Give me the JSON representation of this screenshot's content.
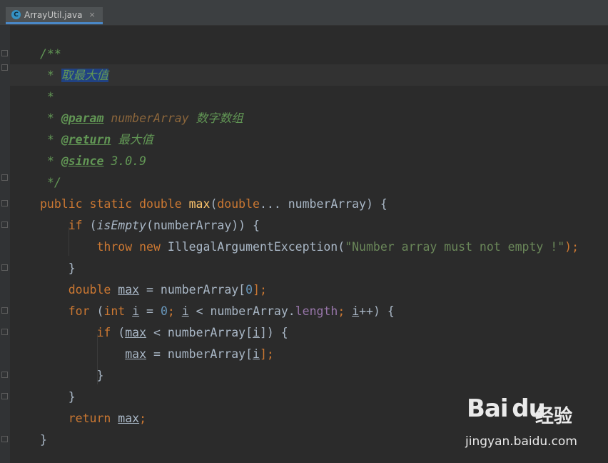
{
  "tab": {
    "icon": "java-class-icon",
    "icon_glyph": "C",
    "title": "ArrayUtil.java",
    "close": "×"
  },
  "code": {
    "l1": "/**",
    "l2_star": " * ",
    "l2_text": "取最大值",
    "l3": " *",
    "l4_star": " * ",
    "l4_tag": "@param",
    "l4_name": " numberArray",
    "l4_text": " 数字数组",
    "l5_star": " * ",
    "l5_tag": "@return",
    "l5_text": " 最大值",
    "l6_star": " * ",
    "l6_tag": "@since",
    "l6_text": " 3.0.9",
    "l7": " */",
    "l8_kw": "public static double ",
    "l8_fn": "max",
    "l8_p1": "(",
    "l8_kw2": "double",
    "l8_rest": "... numberArray) {",
    "l9_indent": "    ",
    "l9_kw": "if",
    "l9_p1": " (",
    "l9_fn": "isEmpty",
    "l9_rest": "(numberArray)) {",
    "l10_indent": "        ",
    "l10_kw": "throw new ",
    "l10_cls": "IllegalArgumentException(",
    "l10_str": "\"Number array must not empty !\"",
    "l10_end": ");",
    "l11": "    }",
    "l12_indent": "    ",
    "l12_kw": "double ",
    "l12_var": "max",
    "l12_mid": " = numberArray[",
    "l12_num": "0",
    "l12_end": "];",
    "l13_indent": "    ",
    "l13_kw": "for",
    "l13_a": " (",
    "l13_kw2": "int ",
    "l13_i1": "i",
    "l13_b": " = ",
    "l13_num": "0",
    "l13_c": "; ",
    "l13_i2": "i",
    "l13_d": " < numberArray.",
    "l13_fld": "length",
    "l13_e": "; ",
    "l13_i3": "i",
    "l13_f": "++) {",
    "l14_indent": "        ",
    "l14_kw": "if",
    "l14_a": " (",
    "l14_var": "max",
    "l14_b": " < numberArray[",
    "l14_i": "i",
    "l14_c": "]) {",
    "l15_indent": "            ",
    "l15_var": "max",
    "l15_b": " = numberArray[",
    "l15_i": "i",
    "l15_c": "];",
    "l16": "        }",
    "l17": "    }",
    "l18_indent": "    ",
    "l18_kw": "return ",
    "l18_var": "max",
    "l18_end": ";",
    "l19": "}"
  },
  "watermark": {
    "brand": "Bai du",
    "cn": "经验",
    "url": "jingyan.baidu.com"
  }
}
